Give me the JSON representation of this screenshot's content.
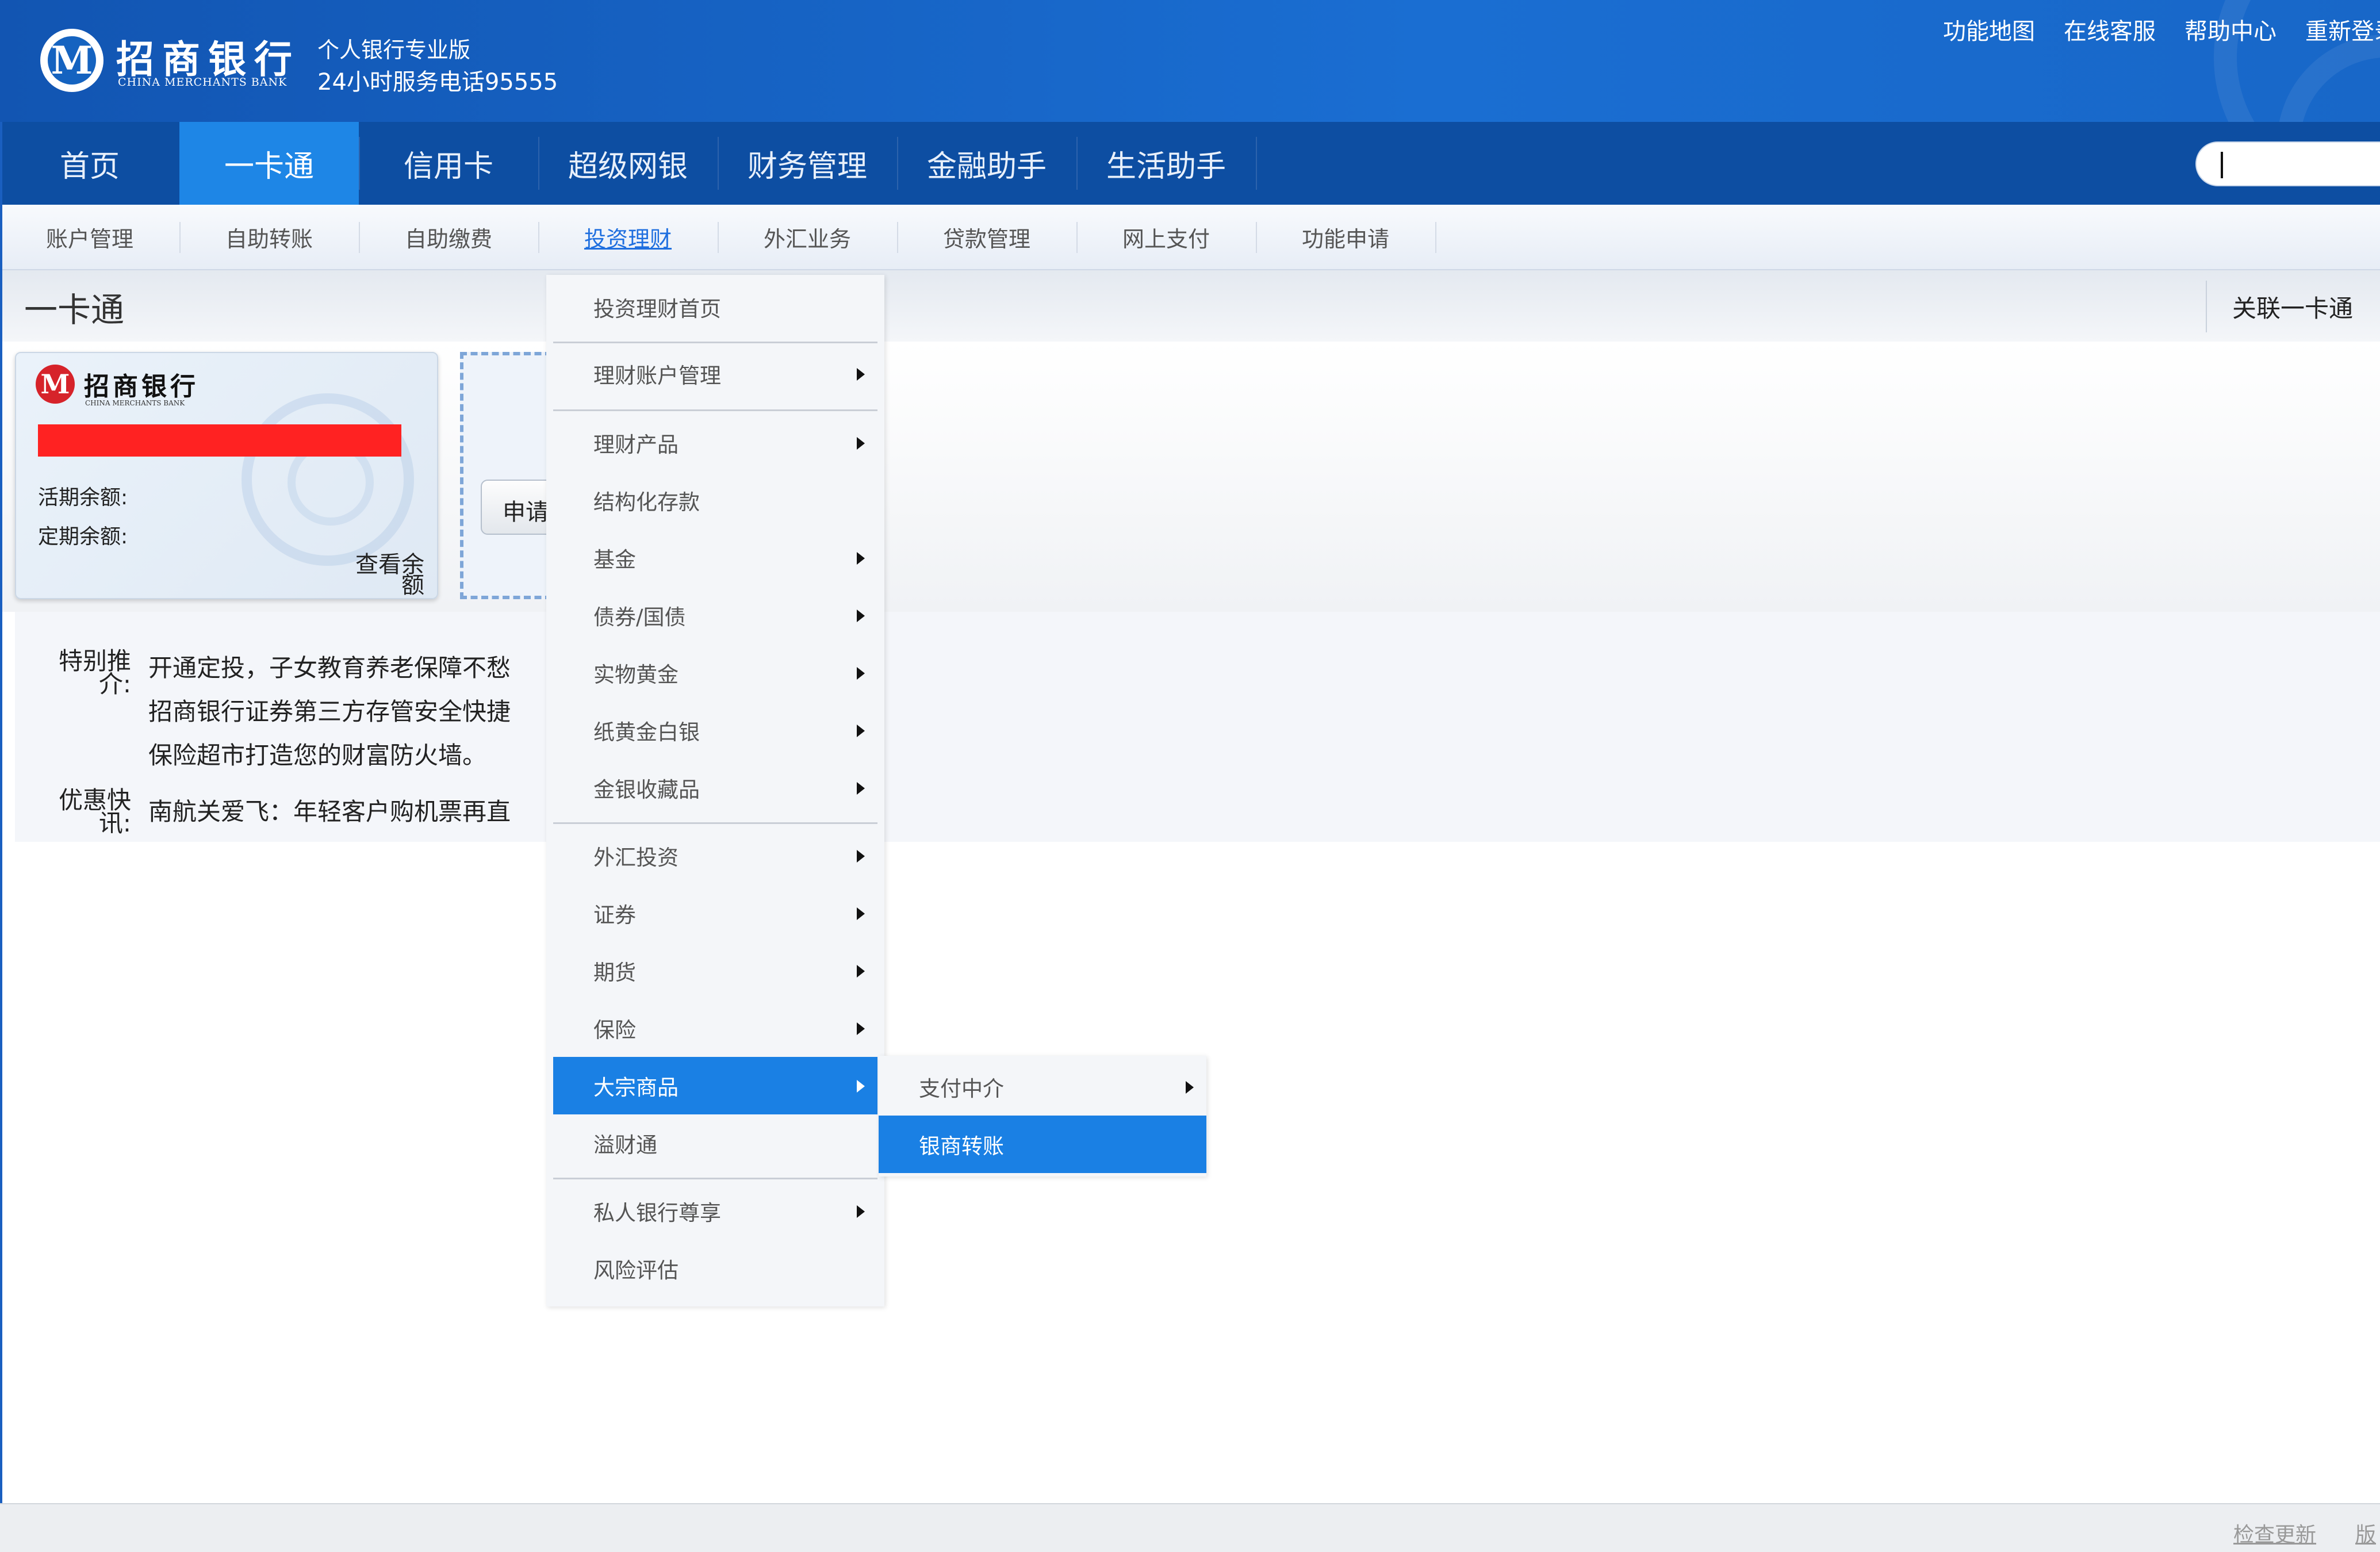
{
  "header": {
    "bank_name_cn": "招商银行",
    "bank_name_en": "CHINA MERCHANTS BANK",
    "logo_glyph": "M",
    "edition": "个人银行专业版",
    "hotline": "24小时服务电话95555",
    "links": [
      "功能地图",
      "在线客服",
      "帮助中心",
      "重新登录"
    ]
  },
  "main_nav": {
    "tabs": [
      "首页",
      "一卡通",
      "信用卡",
      "超级网银",
      "财务管理",
      "金融助手",
      "生活助手"
    ],
    "active": "一卡通"
  },
  "sub_nav": {
    "items": [
      "账户管理",
      "自助转账",
      "自助缴费",
      "投资理财",
      "外汇业务",
      "贷款管理",
      "网上支付",
      "功能申请"
    ],
    "active": "投资理财"
  },
  "section": {
    "title": "一卡通",
    "link_card_button": "关联一卡通"
  },
  "card": {
    "bank_name_cn": "招商银行",
    "bank_name_en": "CHINA MERCHANTS BANK",
    "current_balance_label": "活期余额:",
    "fixed_balance_label": "定期余额:",
    "view_balance": "查看余额",
    "apply_button": "申请"
  },
  "promo": {
    "special_label": "特别推介:",
    "special_lines": [
      "开通定投，子女教育养老保障不愁",
      "招商银行证券第三方存管安全快捷",
      "保险超市打造您的财富防火墙。"
    ],
    "news_label": "优惠快讯:",
    "news_line": "南航关爱飞：年轻客户购机票再直"
  },
  "menu": {
    "items": [
      {
        "label": "投资理财首页",
        "arrow": false
      },
      {
        "label": "理财账户管理",
        "arrow": true
      },
      {
        "label": "理财产品",
        "arrow": true
      },
      {
        "label": "结构化存款",
        "arrow": false
      },
      {
        "label": "基金",
        "arrow": true
      },
      {
        "label": "债券/国债",
        "arrow": true
      },
      {
        "label": "实物黄金",
        "arrow": true
      },
      {
        "label": "纸黄金白银",
        "arrow": true
      },
      {
        "label": "金银收藏品",
        "arrow": true
      },
      {
        "label": "外汇投资",
        "arrow": true
      },
      {
        "label": "证券",
        "arrow": true
      },
      {
        "label": "期货",
        "arrow": true
      },
      {
        "label": "保险",
        "arrow": true
      },
      {
        "label": "大宗商品",
        "arrow": true,
        "selected": true
      },
      {
        "label": "溢财通",
        "arrow": false
      },
      {
        "label": "私人银行尊享",
        "arrow": true
      },
      {
        "label": "风险评估",
        "arrow": false
      }
    ],
    "submenu": [
      {
        "label": "支付中介",
        "arrow": true
      },
      {
        "label": "银商转账",
        "arrow": false,
        "selected": true
      }
    ]
  },
  "footer": {
    "check_update": "检查更新",
    "version": "版"
  },
  "colors": {
    "header_blue": "#1563c0",
    "nav_blue": "#0d4ea2",
    "active_tab": "#1e86e6",
    "menu_highlight": "#1a80e4",
    "redaction": "#ff2222"
  }
}
